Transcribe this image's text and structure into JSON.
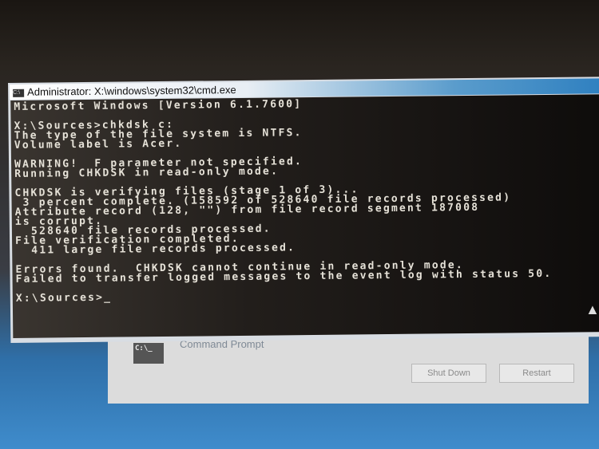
{
  "dialog": {
    "icon": "cmd-icon",
    "icon_text": "C:\\_",
    "title": "Command Prompt",
    "shutdown_label": "Shut Down",
    "restart_label": "Restart"
  },
  "window": {
    "icon": "cmd-icon",
    "icon_text": "C:\\",
    "title": "Administrator: X:\\windows\\system32\\cmd.exe"
  },
  "console": {
    "lines": [
      "Microsoft Windows [Version 6.1.7600]",
      "",
      "X:\\Sources>chkdsk c:",
      "The type of the file system is NTFS.",
      "Volume label is Acer.",
      "",
      "WARNING!  F parameter not specified.",
      "Running CHKDSK in read-only mode.",
      "",
      "CHKDSK is verifying files (stage 1 of 3)...",
      " 3 percent complete. (158592 of 528640 file records processed)",
      "Attribute record (128, \"\") from file record segment 187008",
      "is corrupt.",
      "  528640 file records processed.",
      "File verification completed.",
      "  411 large file records processed.",
      "",
      "Errors found.  CHKDSK cannot continue in read-only mode.",
      "Failed to transfer logged messages to the event log with status 50.",
      "",
      "X:\\Sources>_"
    ]
  }
}
